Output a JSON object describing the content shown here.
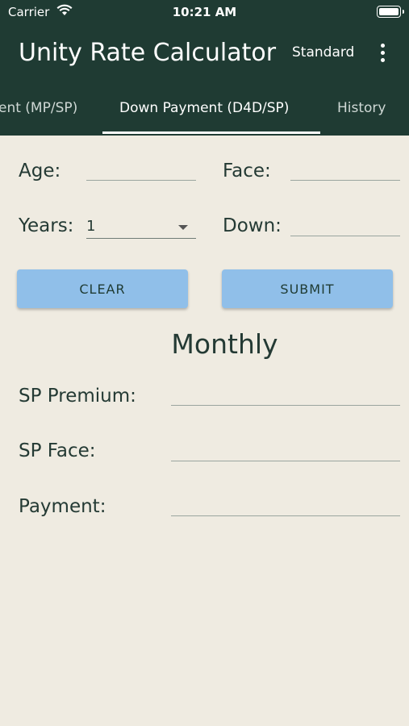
{
  "status_bar": {
    "carrier": "Carrier",
    "time": "10:21 AM"
  },
  "app_bar": {
    "title": "Unity Rate Calculator",
    "mode": "Standard"
  },
  "tabs": [
    {
      "label": "ent (MP/SP)"
    },
    {
      "label": "Down Payment (D4D/SP)"
    },
    {
      "label": "History"
    }
  ],
  "form": {
    "age_label": "Age:",
    "face_label": "Face:",
    "years_label": "Years:",
    "years_value": "1",
    "down_label": "Down:"
  },
  "buttons": {
    "clear": "CLEAR",
    "submit": "SUBMIT"
  },
  "results": {
    "title": "Monthly",
    "sp_premium_label": "SP Premium:",
    "sp_face_label": "SP Face:",
    "payment_label": "Payment:"
  },
  "colors": {
    "app_bar": "#1f3b33",
    "background": "#efebe1",
    "button": "#90bfe9"
  }
}
